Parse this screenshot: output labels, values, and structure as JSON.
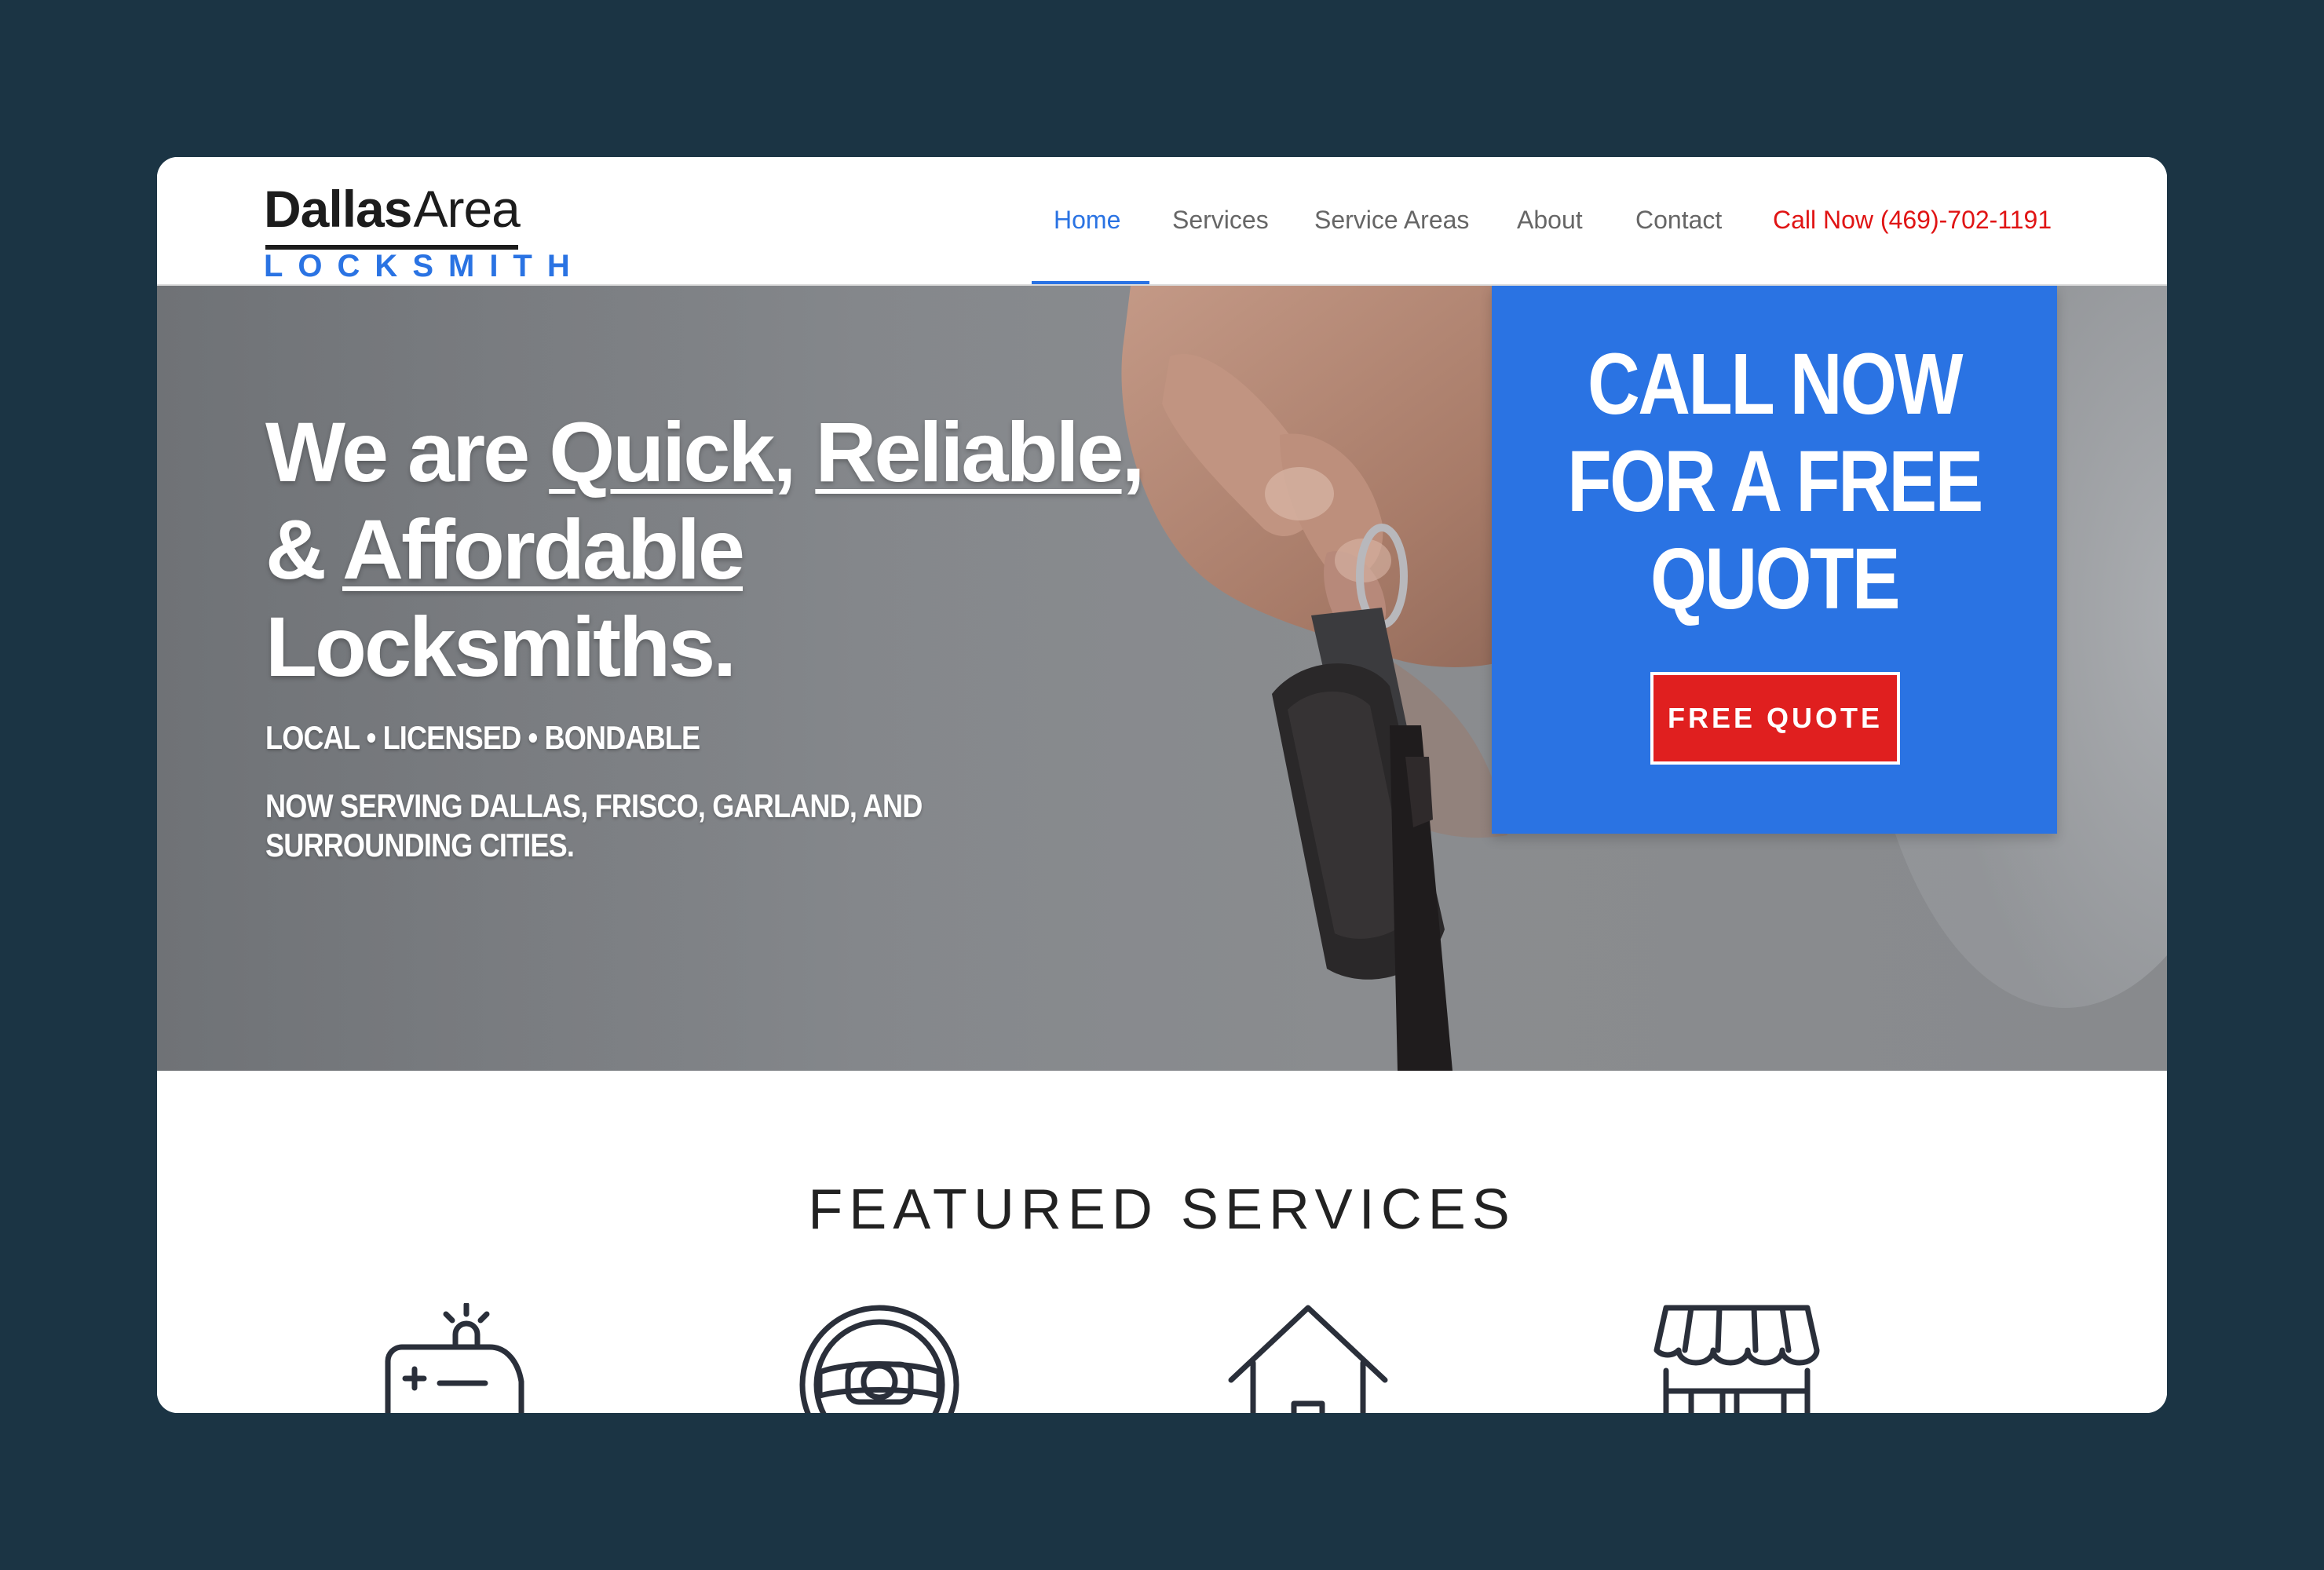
{
  "logo": {
    "line1_bold": "Dallas",
    "line1_light": "Area",
    "line2": "LOCKSMITH"
  },
  "nav": {
    "items": [
      {
        "label": "Home",
        "active": true
      },
      {
        "label": "Services",
        "active": false
      },
      {
        "label": "Service Areas",
        "active": false
      },
      {
        "label": "About",
        "active": false
      },
      {
        "label": "Contact",
        "active": false
      }
    ],
    "call": "Call Now (469)-702-1191"
  },
  "hero": {
    "headline": {
      "w1": "We are ",
      "quick": "Quick",
      "c1": ", ",
      "reliable": "Reliable",
      "c2": ",",
      "amp": "& ",
      "affordable": "Affordable",
      "line3": "Locksmiths."
    },
    "tagline": "LOCAL • LICENSED • BONDABLE",
    "serving": "NOW SERVING DALLAS, FRISCO, GARLAND, AND SURROUNDING CITIES."
  },
  "cta": {
    "lines": [
      "CALL NOW",
      "FOR A FREE",
      "QUOTE"
    ],
    "button": "FREE QUOTE"
  },
  "featured": {
    "title": "FEATURED SERVICES",
    "icons": [
      "ambulance-icon",
      "steering-wheel-icon",
      "house-icon",
      "storefront-icon"
    ]
  },
  "colors": {
    "accent_blue": "#2a73e3",
    "call_red": "#e01414",
    "button_red": "#e01f1f",
    "page_bg": "#1b3444"
  }
}
